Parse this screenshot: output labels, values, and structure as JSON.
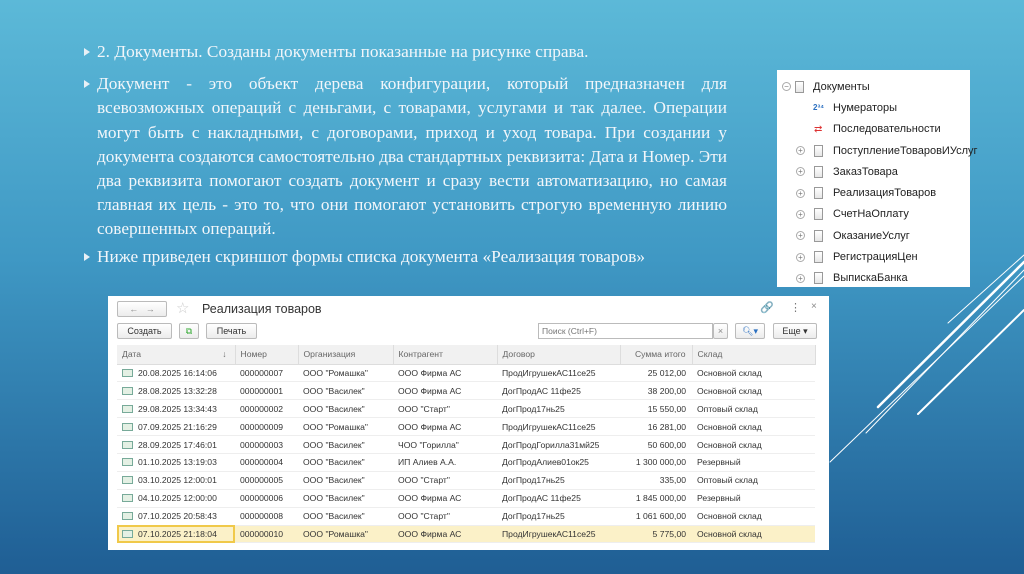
{
  "bullets": [
    "2. Документы. Созданы документы показанные на рисунке справа.",
    "Документ - это объект дерева конфигурации, который предназначен для всевозможных операций с  деньгами, с товарами, услугами и так далее. Операции могут быть с накладными, с договорами, приход и уход товара. При создании у документа создаются самостоятельно два стандартных реквизита: Дата и Номер. Эти два реквизита помогают создать документ и сразу вести автоматизацию, но самая главная их цель - это то, что они помогают установить строгую временную линию совершенных операций.",
    "Ниже приведен скриншот формы списка документа «Реализация товаров»"
  ],
  "tree": {
    "root": "Документы",
    "numerators": "Нумераторы",
    "sequences": "Последовательности",
    "items": [
      "ПоступлениеТоваровИУслуг",
      "ЗаказТовара",
      "РеализацияТоваров",
      "СчетНаОплату",
      "ОказаниеУслуг",
      "РегистрацияЦен",
      "ВыпискаБанка"
    ]
  },
  "window": {
    "title": "Реализация товаров",
    "create": "Создать",
    "print": "Печать",
    "search_placeholder": "Поиск (Ctrl+F)",
    "more": "Еще",
    "sort_arrow": "↓"
  },
  "table": {
    "headers": [
      "Дата",
      "Номер",
      "Организация",
      "Контрагент",
      "Договор",
      "Сумма итого",
      "Склад"
    ],
    "rows": [
      [
        "20.08.2025 16:14:06",
        "000000007",
        "ООО \"Ромашка\"",
        "ООО Фирма АС",
        "ПродИгрушекАС11се25",
        "25 012,00",
        "Основной склад"
      ],
      [
        "28.08.2025 13:32:28",
        "000000001",
        "ООО \"Василек\"",
        "ООО Фирма АС",
        "ДогПродАС 11фе25",
        "38 200,00",
        "Основной склад"
      ],
      [
        "29.08.2025 13:34:43",
        "000000002",
        "ООО \"Василек\"",
        "ООО \"Старт\"",
        "ДогПрод17нь25",
        "15 550,00",
        "Оптовый склад"
      ],
      [
        "07.09.2025 21:16:29",
        "000000009",
        "ООО \"Ромашка\"",
        "ООО Фирма АС",
        "ПродИгрушекАС11се25",
        "16 281,00",
        "Основной склад"
      ],
      [
        "28.09.2025 17:46:01",
        "000000003",
        "ООО \"Василек\"",
        "ЧОО \"Горилла\"",
        "ДогПродГорилла31мй25",
        "50 600,00",
        "Основной склад"
      ],
      [
        "01.10.2025 13:19:03",
        "000000004",
        "ООО \"Василек\"",
        "ИП Алиев А.А.",
        "ДогПродАлиев01ок25",
        "1 300 000,00",
        "Резервный"
      ],
      [
        "03.10.2025 12:00:01",
        "000000005",
        "ООО \"Василек\"",
        "ООО \"Старт\"",
        "ДогПрод17нь25",
        "335,00",
        "Оптовый склад"
      ],
      [
        "04.10.2025 12:00:00",
        "000000006",
        "ООО \"Василек\"",
        "ООО Фирма АС",
        "ДогПродАС 11фе25",
        "1 845 000,00",
        "Резервный"
      ],
      [
        "07.10.2025 20:58:43",
        "000000008",
        "ООО \"Василек\"",
        "ООО \"Старт\"",
        "ДогПрод17нь25",
        "1 061 600,00",
        "Основной склад"
      ],
      [
        "07.10.2025 21:18:04",
        "000000010",
        "ООО \"Ромашка\"",
        "ООО Фирма АС",
        "ПродИгрушекАС11се25",
        "5 775,00",
        "Основной склад"
      ]
    ]
  }
}
